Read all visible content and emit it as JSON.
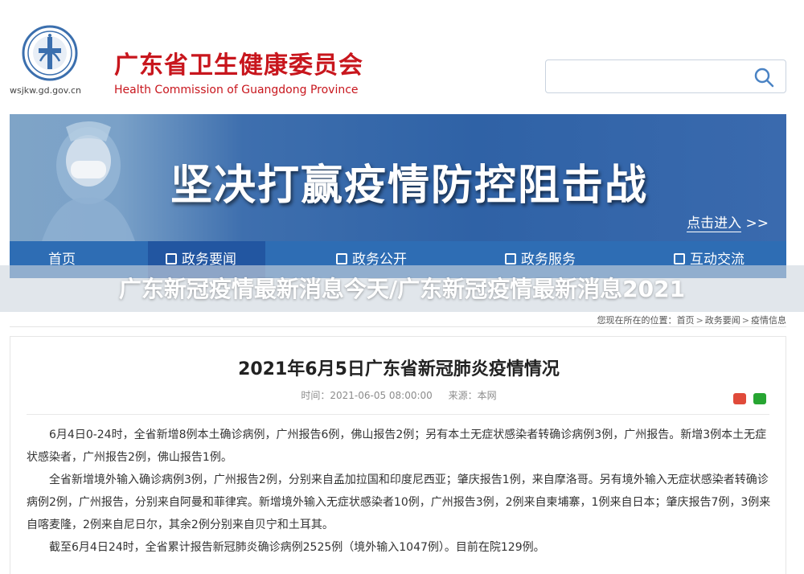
{
  "header": {
    "site_url": "wsjkw.gd.gov.cn",
    "org_name_cn": "广东省卫生健康委员会",
    "org_name_en": "Health Commission of Guangdong Province",
    "emblem_icon": "health-emblem-icon",
    "search": {
      "placeholder": "",
      "value": "",
      "icon": "search-icon"
    }
  },
  "banner": {
    "slogan": "坚决打赢疫情防控阻击战",
    "link_label": "点击进入",
    "link_arrows": ">>"
  },
  "nav": {
    "items": [
      {
        "label": "首页"
      },
      {
        "label": "政务要闻"
      },
      {
        "label": "政务公开"
      },
      {
        "label": "政务服务"
      },
      {
        "label": "互动交流"
      }
    ],
    "active_index": 1
  },
  "overlay_title": "广东新冠疫情最新消息今天/广东新冠疫情最新消息2021",
  "breadcrumb": {
    "prefix": "您现在所在的位置：",
    "items": [
      "首页",
      "政务要闻",
      "疫情信息"
    ],
    "separator": ">"
  },
  "article": {
    "title": "2021年6月5日广东省新冠肺炎疫情情况",
    "time": "时间：2021-06-05 08:00:00",
    "source": "来源：本网",
    "share_icons": [
      "weibo-share-icon",
      "wechat-share-icon"
    ],
    "paragraphs": [
      "6月4日0-24时，全省新增8例本土确诊病例，广州报告6例，佛山报告2例；另有本土无症状感染者转确诊病例3例，广州报告。新增3例本土无症状感染者，广州报告2例，佛山报告1例。",
      "全省新增境外输入确诊病例3例，广州报告2例，分别来自孟加拉国和印度尼西亚；肇庆报告1例，来自摩洛哥。另有境外输入无症状感染者转确诊病例2例，广州报告，分别来自阿曼和菲律宾。新增境外输入无症状感染者10例，广州报告3例，2例来自柬埔寨，1例来自日本；肇庆报告7例，3例来自喀麦隆，2例来自尼日尔，其余2例分别来自贝宁和土耳其。",
      "截至6月4日24时，全省累计报告新冠肺炎确诊病例2525例（境外输入1047例）。目前在院129例。"
    ]
  },
  "colors": {
    "brand_red": "#c8161d",
    "nav_blue": "#2e6db4",
    "nav_active": "#2256a1",
    "banner_blue": "#2f62a6"
  }
}
